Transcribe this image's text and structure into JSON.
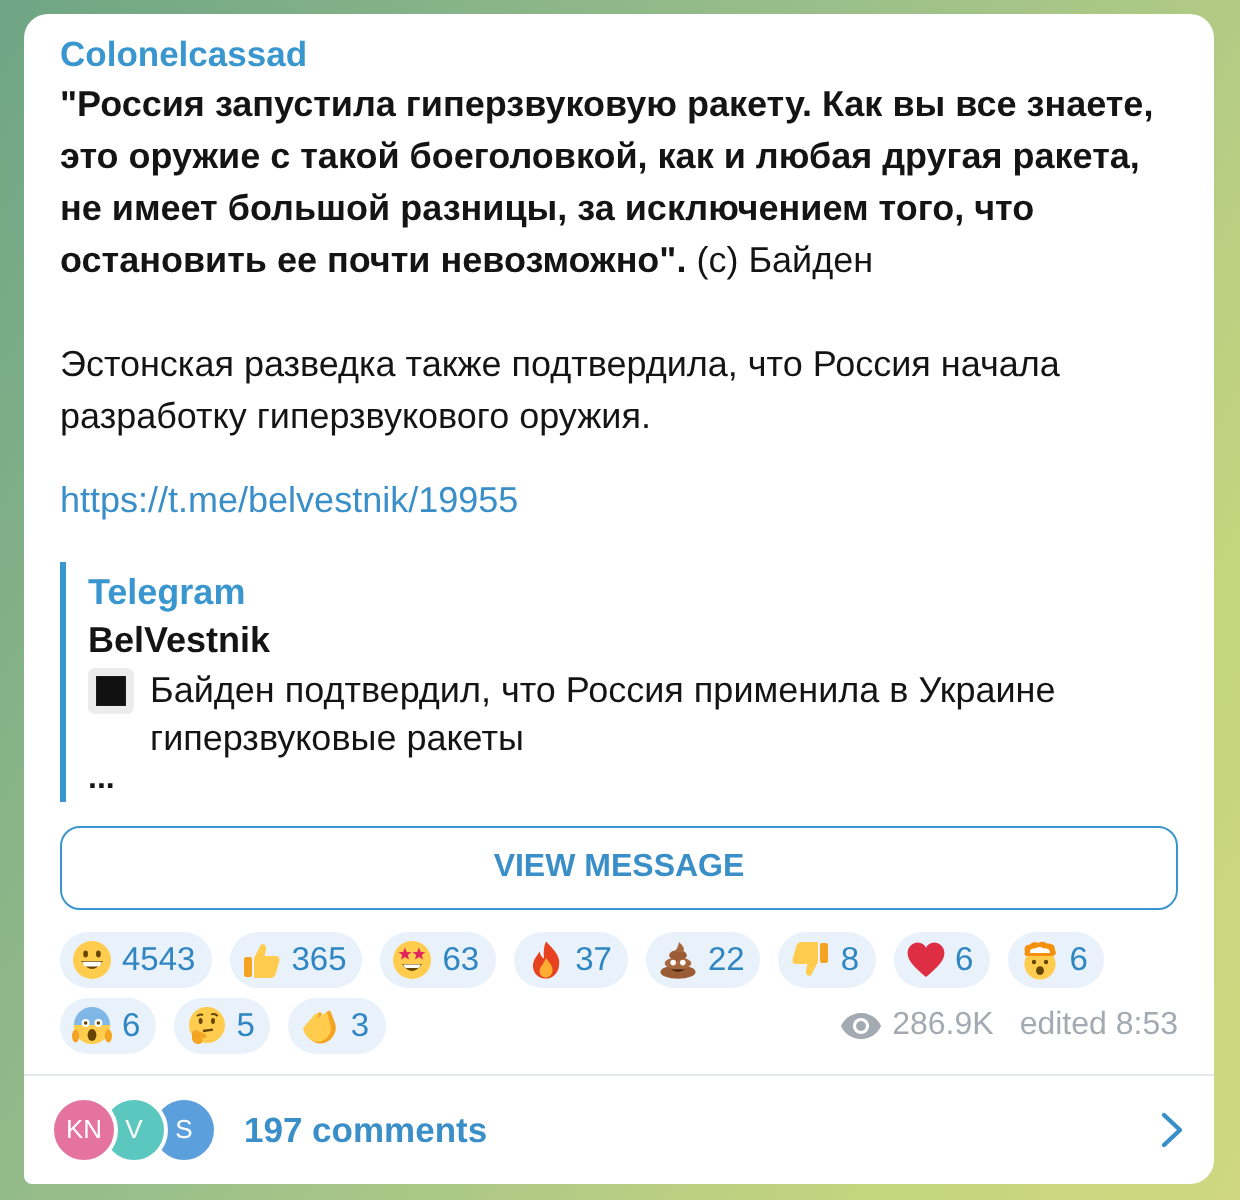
{
  "post": {
    "channel": "Colonelcassad",
    "paragraphs": [
      "**\"Россия запустила гиперзвуковую ракету. Как вы все знаете, это оружие с такой боеголовкой, как и любая другая ракета, не имеет большой разницы, за исключением того, что остановить ее почти невозможно\".** (с) Байден",
      "Эстонская разведка также подтвердила, что Россия начала разработку гиперзвукового оружия."
    ],
    "link": "https://t.me/belvestnik/19955"
  },
  "preview": {
    "site": "Telegram",
    "title": "BelVestnik",
    "text": "Байден подтвердил, что Россия применила в Украине гиперзвуковые ракеты",
    "more": "..."
  },
  "view_button": "VIEW MESSAGE",
  "reactions": [
    {
      "kind": "grin",
      "count": "4543"
    },
    {
      "kind": "thumbs_up",
      "count": "365"
    },
    {
      "kind": "star_struck",
      "count": "63"
    },
    {
      "kind": "fire",
      "count": "37"
    },
    {
      "kind": "poop",
      "count": "22"
    },
    {
      "kind": "thumbs_down",
      "count": "8"
    },
    {
      "kind": "heart",
      "count": "6"
    },
    {
      "kind": "exploding_head",
      "count": "6"
    },
    {
      "kind": "scream",
      "count": "6"
    },
    {
      "kind": "thinking",
      "count": "5"
    },
    {
      "kind": "clap",
      "count": "3"
    }
  ],
  "views": "286.9K",
  "edited": "edited 8:53",
  "comments": {
    "avatars": [
      {
        "initials": "KN",
        "color": "#e5739f"
      },
      {
        "initials": "V",
        "color": "#5cc7bf"
      },
      {
        "initials": "S",
        "color": "#5b9fdc"
      }
    ],
    "label": "197 comments"
  }
}
